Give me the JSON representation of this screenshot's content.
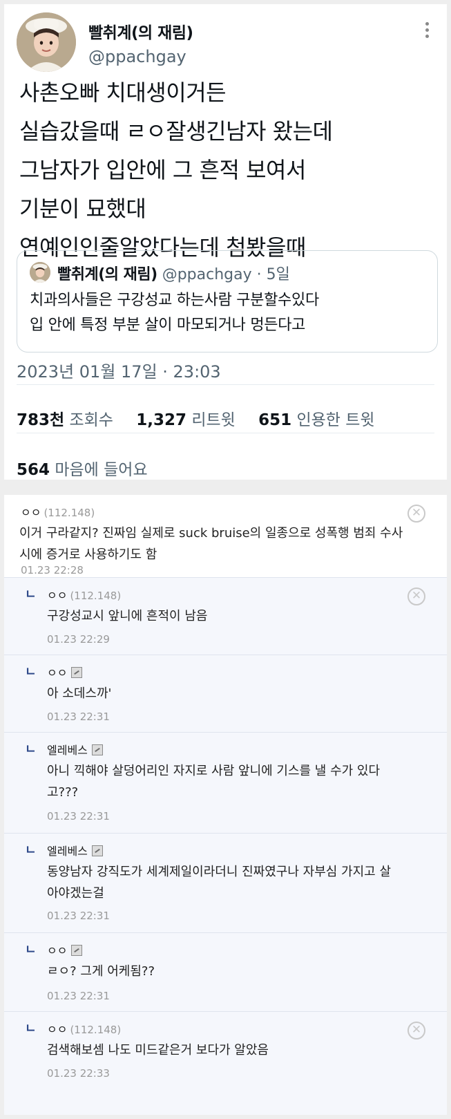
{
  "tweet": {
    "author_name": "빨취계(의 재림)",
    "author_handle": "@ppachgay",
    "body_lines": [
      "사촌오빠 치대생이거든",
      "실습갔을때 ㄹㅇ잘생긴남자 왔는데",
      "그남자가 입안에 그 흔적 보여서",
      "기분이 묘했대",
      "연예인인줄알았다는데 첨봤을때"
    ],
    "quote": {
      "author_name": "빨취계(의 재림)",
      "meta": "@ppachgay · 5일",
      "body_lines": [
        "치과의사들은 구강성교 하는사람 구분할수있다",
        "입 안에 특정 부분 살이 마모되거나 멍든다고"
      ]
    },
    "timestamp": "2023년 01월 17일 · 23:03",
    "stats": {
      "views_num": "783천",
      "views_label": "조회수",
      "retweets_num": "1,327",
      "retweets_label": "리트윗",
      "quotes_num": "651",
      "quotes_label": "인용한 트윗"
    },
    "likes": {
      "num": "564",
      "label": "마음에 들어요"
    }
  },
  "comments": [
    {
      "nick": "ㅇㅇ",
      "ip": "(112.148)",
      "lines": [
        "이거 구라같지? 진짜임 실제로 suck bruise의 일종으로 성폭행 범죄 수사",
        "시에 증거로 사용하기도 함"
      ],
      "date": "01.23 22:28",
      "reply": false,
      "deletable": true
    },
    {
      "nick": "ㅇㅇ",
      "ip": "(112.148)",
      "lines": [
        "구강성교시 앞니에 흔적이 남음"
      ],
      "date": "01.23 22:29",
      "reply": true,
      "deletable": true
    },
    {
      "nick": "ㅇㅇ",
      "ip": "",
      "lines": [
        "아 소데스까'"
      ],
      "date": "01.23 22:31",
      "reply": true,
      "deletable": false
    },
    {
      "nick": "엘레베스",
      "ip": "",
      "lines": [
        "아니 끽해야 살덩어리인 자지로 사람 앞니에 기스를 낼 수가 있다",
        "고???"
      ],
      "date": "01.23 22:31",
      "reply": true,
      "deletable": false
    },
    {
      "nick": "엘레베스",
      "ip": "",
      "lines": [
        "동양남자 강직도가 세계제일이라더니 진짜였구나 자부심 가지고 살",
        "아야겠는걸"
      ],
      "date": "01.23 22:31",
      "reply": true,
      "deletable": false
    },
    {
      "nick": "ㅇㅇ",
      "ip": "",
      "lines": [
        "ㄹㅇ? 그게 어케됨??"
      ],
      "date": "01.23 22:31",
      "reply": true,
      "deletable": false
    },
    {
      "nick": "ㅇㅇ",
      "ip": "(112.148)",
      "lines": [
        "검색해보셈 나도 미드같은거 보다가 알았음"
      ],
      "date": "01.23 22:33",
      "reply": true,
      "deletable": true
    }
  ],
  "ui": {
    "reply_mark": "ㄴ",
    "delete_glyph": "✕",
    "avatar_icon": "profile-photo-icon",
    "more_icon": "more-options-icon",
    "badge_icon": "fixed-nick-badge-icon"
  }
}
